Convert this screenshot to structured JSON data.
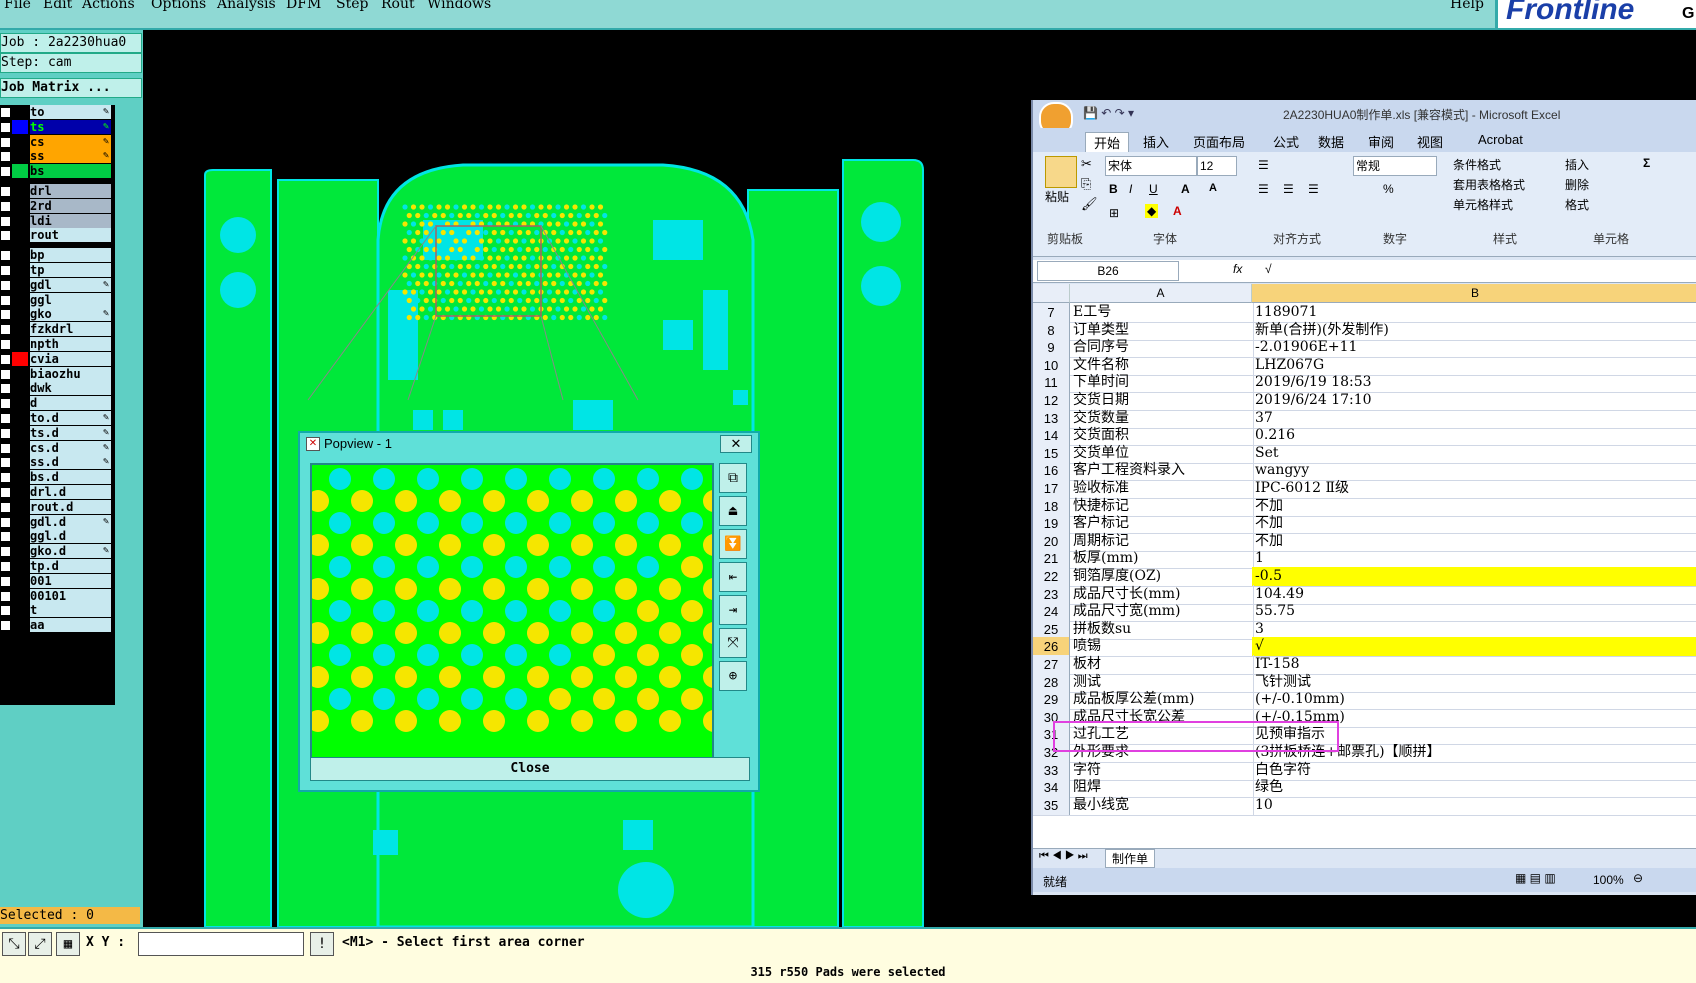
{
  "menubar": {
    "items": [
      "File",
      "Edit",
      "Actions",
      "Options",
      "Analysis",
      "DFM",
      "Step",
      "Rout",
      "Windows"
    ],
    "help": "Help",
    "logo": "Frontline",
    "logo_cut": "G"
  },
  "leftpanel": {
    "job": "Job : 2a2230hua0",
    "step": "Step: cam",
    "matrix_button": "Job Matrix ...",
    "layers": [
      {
        "name": "to",
        "style": "lite",
        "swatch": "#000",
        "affected": true
      },
      {
        "name": "ts",
        "style": "ts",
        "swatch": "#00f",
        "affected": true
      },
      {
        "name": "cs",
        "style": "cs",
        "swatch": "#000",
        "affected": true
      },
      {
        "name": "ss",
        "style": "cs",
        "swatch": "#000",
        "affected": true
      },
      {
        "name": "bs",
        "style": "bs",
        "swatch": "#0c4",
        "affected": false
      },
      {
        "name": "drl",
        "style": "dim",
        "swatch": "#000",
        "affected": false
      },
      {
        "name": "2rd",
        "style": "dim",
        "swatch": "#000",
        "affected": false
      },
      {
        "name": "ldi",
        "style": "dim",
        "swatch": "#000",
        "affected": false
      },
      {
        "name": "rout",
        "style": "lite",
        "swatch": "#000",
        "affected": false
      },
      {
        "name": "bp",
        "style": "lite",
        "swatch": "#000",
        "affected": false
      },
      {
        "name": "tp",
        "style": "lite",
        "swatch": "#000",
        "affected": false
      },
      {
        "name": "gdl",
        "style": "lite",
        "swatch": "#000",
        "affected": true
      },
      {
        "name": "ggl",
        "style": "lite",
        "swatch": "#000",
        "affected": false
      },
      {
        "name": "gko",
        "style": "lite",
        "swatch": "#000",
        "affected": true
      },
      {
        "name": "fzkdrl",
        "style": "lite",
        "swatch": "#000",
        "affected": false
      },
      {
        "name": "npth",
        "style": "lite",
        "swatch": "#000",
        "affected": false
      },
      {
        "name": "cvia",
        "style": "lite",
        "swatch": "#f00",
        "affected": false
      },
      {
        "name": "biaozhu",
        "style": "lite",
        "swatch": "#000",
        "affected": false
      },
      {
        "name": "dwk",
        "style": "lite",
        "swatch": "#000",
        "affected": false
      },
      {
        "name": "d",
        "style": "lite",
        "swatch": "#000",
        "affected": false
      },
      {
        "name": "to.d",
        "style": "lite",
        "swatch": "#000",
        "affected": true
      },
      {
        "name": "ts.d",
        "style": "lite",
        "swatch": "#000",
        "affected": true
      },
      {
        "name": "cs.d",
        "style": "lite",
        "swatch": "#000",
        "affected": true
      },
      {
        "name": "ss.d",
        "style": "lite",
        "swatch": "#000",
        "affected": true
      },
      {
        "name": "bs.d",
        "style": "lite",
        "swatch": "#000",
        "affected": false
      },
      {
        "name": "drl.d",
        "style": "lite",
        "swatch": "#000",
        "affected": false
      },
      {
        "name": "rout.d",
        "style": "lite",
        "swatch": "#000",
        "affected": false
      },
      {
        "name": "gdl.d",
        "style": "lite",
        "swatch": "#000",
        "affected": true
      },
      {
        "name": "ggl.d",
        "style": "lite",
        "swatch": "#000",
        "affected": false
      },
      {
        "name": "gko.d",
        "style": "lite",
        "swatch": "#000",
        "affected": true
      },
      {
        "name": "tp.d",
        "style": "lite",
        "swatch": "#000",
        "affected": false
      },
      {
        "name": "001",
        "style": "lite",
        "swatch": "#000",
        "affected": false
      },
      {
        "name": "00101",
        "style": "lite",
        "swatch": "#000",
        "affected": false
      },
      {
        "name": "t",
        "style": "lite",
        "swatch": "#000",
        "affected": false
      },
      {
        "name": "aa",
        "style": "lite",
        "swatch": "#000",
        "affected": false
      }
    ],
    "selected": "Selected : 0"
  },
  "popview": {
    "title": "Popview - 1",
    "close_x": "✕",
    "close_button": "Close",
    "tools": [
      "⧉",
      "⏏",
      "⏬",
      "⇤",
      "⇥",
      "⤧",
      "⊕"
    ]
  },
  "excel": {
    "title": "2A2230HUA0制作单.xls [兼容模式] - Microsoft Excel",
    "tabs": [
      "开始",
      "插入",
      "页面布局",
      "公式",
      "数据",
      "审阅",
      "视图",
      "Acrobat"
    ],
    "ribbon": {
      "paste": "粘贴",
      "font_name": "宋体",
      "font_size": "12",
      "number_format": "常规",
      "cond_format": "条件格式",
      "table_format": "套用表格格式",
      "cell_style": "单元格样式",
      "insert": "插入",
      "delete": "删除",
      "format": "格式",
      "sigma": "Σ",
      "groups": [
        "剪贴板",
        "字体",
        "对齐方式",
        "数字",
        "样式",
        "单元格"
      ]
    },
    "name_box": "B26",
    "fx": "fx",
    "formula": "√",
    "col_a": "A",
    "col_b": "B",
    "rows": [
      {
        "n": "7",
        "a": "E工号",
        "b": "1189071",
        "yel": false
      },
      {
        "n": "8",
        "a": "订单类型",
        "b": "新单(合拼)(外发制作)",
        "yel": false
      },
      {
        "n": "9",
        "a": "合同序号",
        "b": "-2.01906E+11",
        "yel": false
      },
      {
        "n": "10",
        "a": "文件名称",
        "b": "LHZ067G",
        "yel": false
      },
      {
        "n": "11",
        "a": "下单时间",
        "b": "2019/6/19 18:53",
        "yel": false
      },
      {
        "n": "12",
        "a": "交货日期",
        "b": "2019/6/24 17:10",
        "yel": false
      },
      {
        "n": "13",
        "a": "交货数量",
        "b": "37",
        "yel": false
      },
      {
        "n": "14",
        "a": "交货面积",
        "b": "0.216",
        "yel": false
      },
      {
        "n": "15",
        "a": "交货单位",
        "b": "Set",
        "yel": false
      },
      {
        "n": "16",
        "a": "客户工程资料录入",
        "b": "wangyy",
        "yel": false
      },
      {
        "n": "17",
        "a": "验收标准",
        "b": "IPC-6012 Ⅱ级",
        "yel": false
      },
      {
        "n": "18",
        "a": "快捷标记",
        "b": "不加",
        "yel": false
      },
      {
        "n": "19",
        "a": "客户标记",
        "b": "不加",
        "yel": false
      },
      {
        "n": "20",
        "a": "周期标记",
        "b": "不加",
        "yel": false
      },
      {
        "n": "21",
        "a": "板厚(mm)",
        "b": "1",
        "yel": false
      },
      {
        "n": "22",
        "a": "铜箔厚度(OZ)",
        "b": "-0.5",
        "yel": true
      },
      {
        "n": "23",
        "a": "成品尺寸长(mm)",
        "b": "104.49",
        "yel": false
      },
      {
        "n": "24",
        "a": "成品尺寸宽(mm)",
        "b": "55.75",
        "yel": false
      },
      {
        "n": "25",
        "a": "拼板数su",
        "b": "3",
        "yel": false
      },
      {
        "n": "26",
        "a": "喷锡",
        "b": "√",
        "yel": true
      },
      {
        "n": "27",
        "a": "板材",
        "b": "IT-158",
        "yel": false
      },
      {
        "n": "28",
        "a": "测试",
        "b": "飞针测试",
        "yel": false
      },
      {
        "n": "29",
        "a": "成品板厚公差(mm)",
        "b": "(+/-0.10mm)",
        "yel": false
      },
      {
        "n": "30",
        "a": "成品尺寸长宽公差",
        "b": "(+/-0.15mm)",
        "yel": false
      },
      {
        "n": "31",
        "a": "过孔工艺",
        "b": "见预审指示",
        "yel": false
      },
      {
        "n": "32",
        "a": "外形要求",
        "b": "(3拼板桥连+邮票孔)【顺拼】",
        "yel": false
      },
      {
        "n": "33",
        "a": "字符",
        "b": "白色字符",
        "yel": false
      },
      {
        "n": "34",
        "a": "阻焊",
        "b": "绿色",
        "yel": false
      },
      {
        "n": "35",
        "a": "最小线宽",
        "b": "10",
        "yel": false
      }
    ],
    "sheet_tab": "制作单",
    "status_ready": "就绪",
    "zoom": "100%"
  },
  "bottombar": {
    "xy_label": "X Y :",
    "xy_value": "",
    "prompt": "<M1> - Select first area corner"
  },
  "statusline": "315 r550 Pads were selected",
  "colors": {
    "board": "#00e83a",
    "copper": "#00e5e5",
    "pad_yellow": "#f5e600",
    "panel": "#5fcfc4"
  }
}
